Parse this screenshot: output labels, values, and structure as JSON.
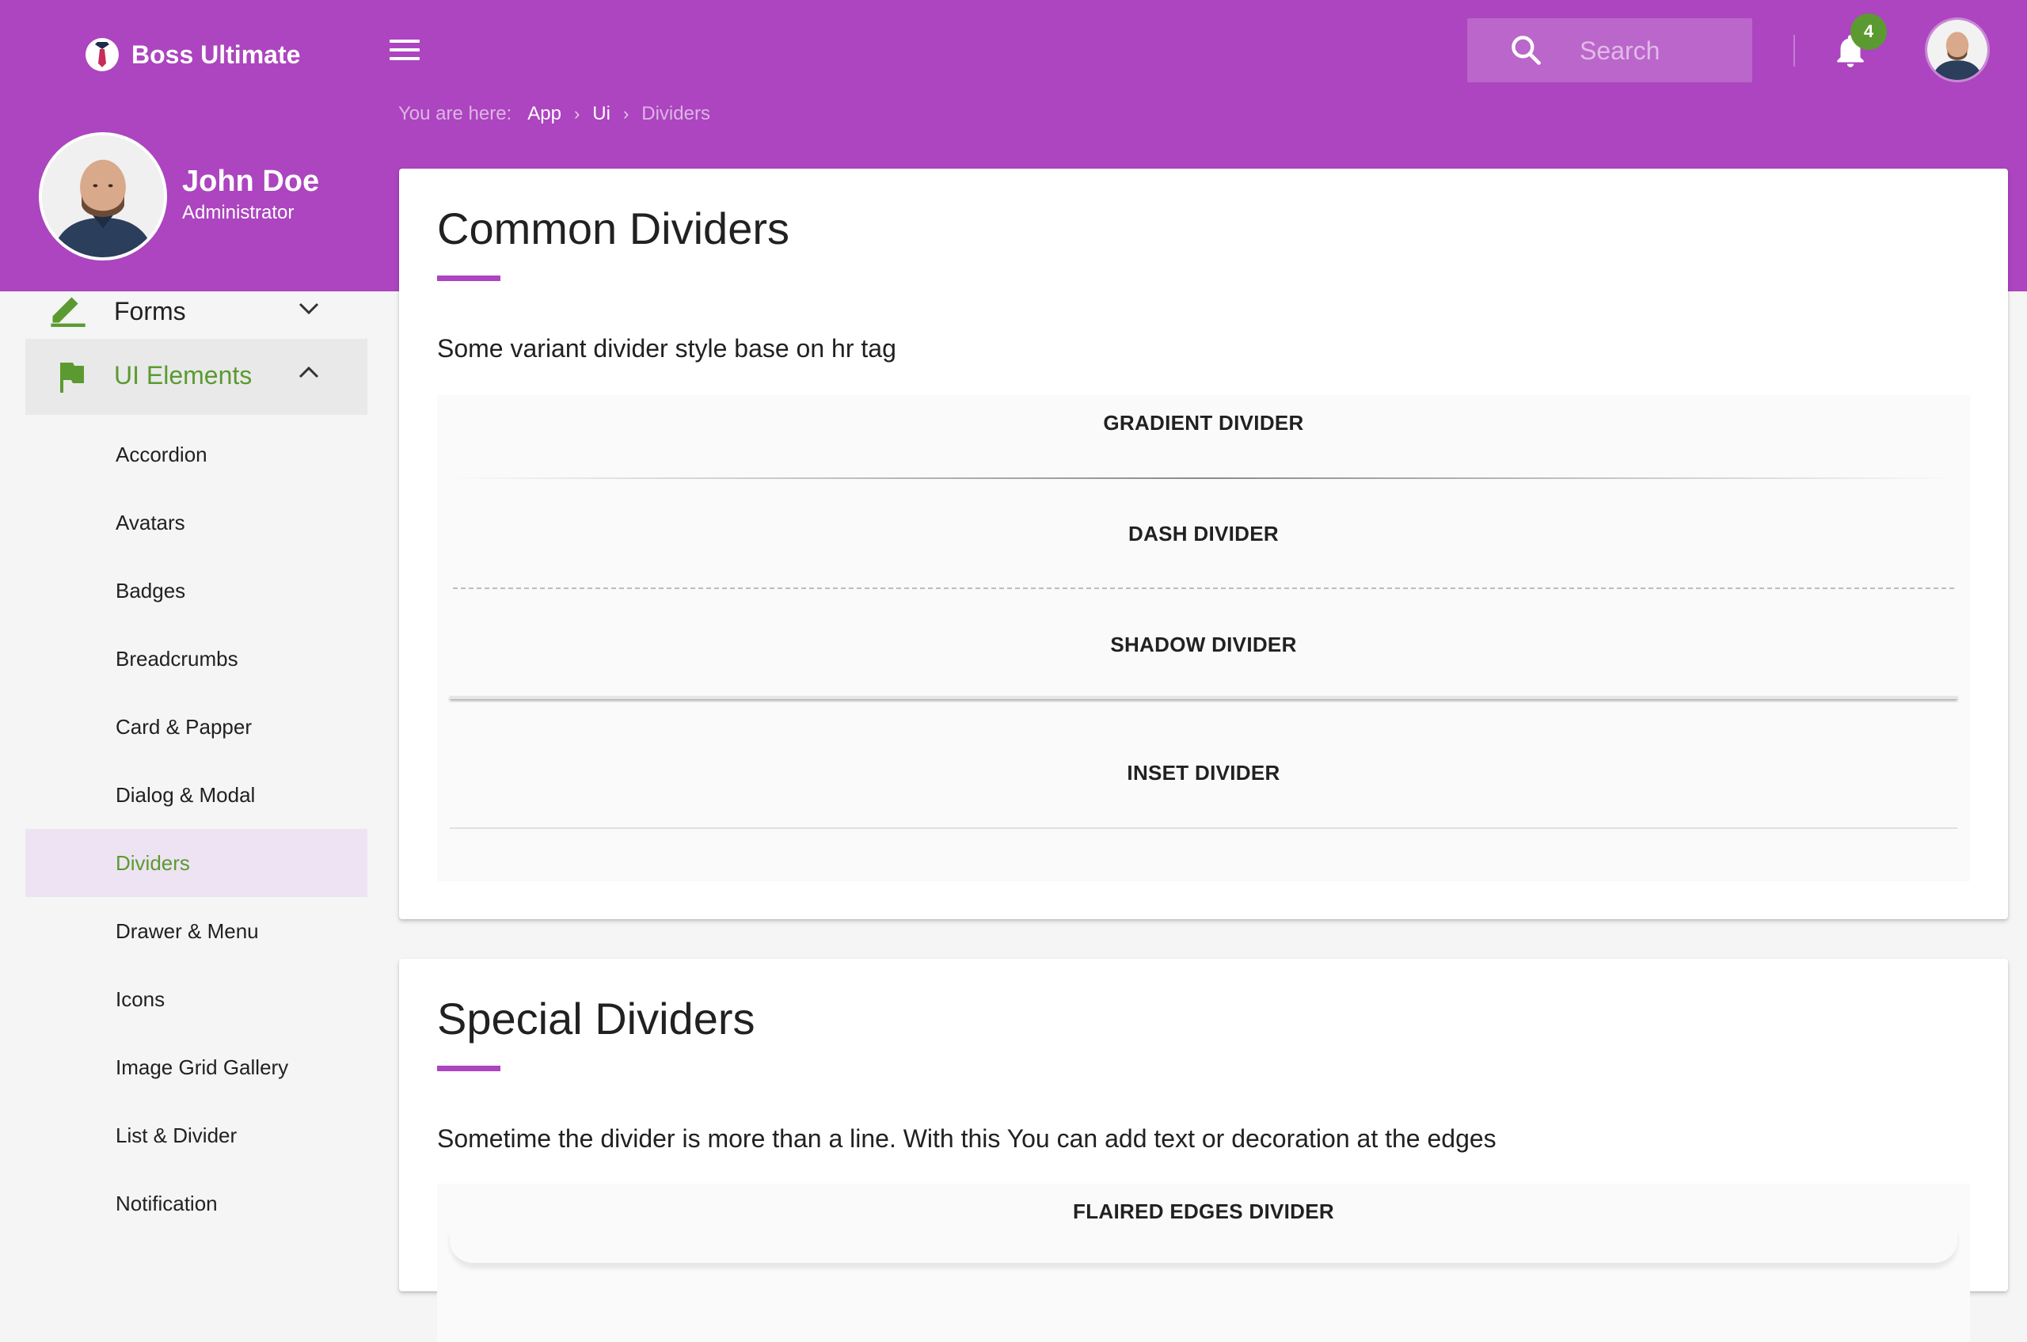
{
  "app": {
    "brand_name": "Boss Ultimate"
  },
  "header": {
    "search_placeholder": "Search",
    "notification_count": "4"
  },
  "breadcrumb": {
    "prefix": "You are here:",
    "items": [
      "App",
      "Ui"
    ],
    "current": "Dividers"
  },
  "profile": {
    "name": "John Doe",
    "role": "Administrator"
  },
  "sidebar": {
    "forms_label": "Forms",
    "ui_label": "UI Elements",
    "items": [
      "Accordion",
      "Avatars",
      "Badges",
      "Breadcrumbs",
      "Card & Papper",
      "Dialog & Modal",
      "Dividers",
      "Drawer & Menu",
      "Icons",
      "Image Grid Gallery",
      "List & Divider",
      "Notification"
    ],
    "active_item": "Dividers"
  },
  "common": {
    "title": "Common Dividers",
    "description": "Some variant divider style base on hr tag",
    "dividers": [
      "GRADIENT DIVIDER",
      "DASH DIVIDER",
      "SHADOW DIVIDER",
      "INSET DIVIDER"
    ]
  },
  "special": {
    "title": "Special Dividers",
    "description": "Sometime the divider is more than a line. With this You can add text or decoration at the edges",
    "dividers": [
      "FLAIRED EDGES DIVIDER"
    ]
  },
  "colors": {
    "primary": "#ac45bf",
    "accent_green": "#5b9a30",
    "active_bg": "#ede3f2"
  }
}
